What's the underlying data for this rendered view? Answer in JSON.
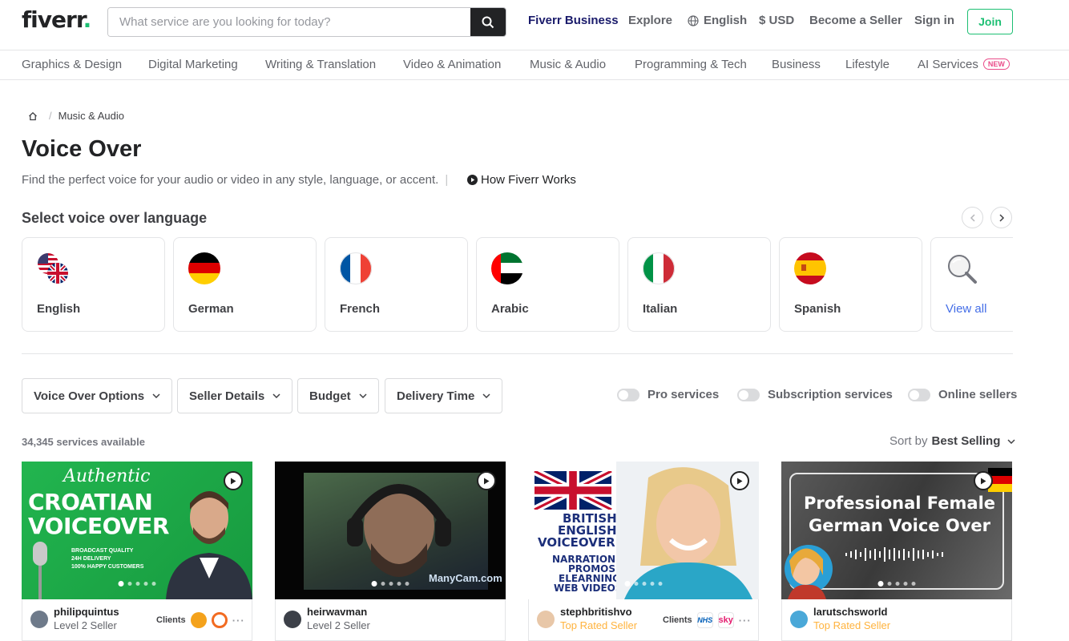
{
  "header": {
    "logo": "fiverr",
    "logo_dot": ".",
    "search_placeholder": "What service are you looking for today?",
    "nav": {
      "business": "Fiverr Business",
      "explore": "Explore",
      "language": "English",
      "currency": "$ USD",
      "become_seller": "Become a Seller",
      "sign_in": "Sign in",
      "join": "Join"
    }
  },
  "categories": [
    "Graphics & Design",
    "Digital Marketing",
    "Writing & Translation",
    "Video & Animation",
    "Music & Audio",
    "Programming & Tech",
    "Business",
    "Lifestyle",
    "AI Services"
  ],
  "new_badge": "NEW",
  "breadcrumb": {
    "sep": "/",
    "current": "Music & Audio"
  },
  "page": {
    "title": "Voice Over",
    "subtitle": "Find the perfect voice for your audio or video in any style, language, or accent.",
    "how_link": "How Fiverr Works"
  },
  "languages": {
    "heading": "Select voice over language",
    "items": [
      "English",
      "German",
      "French",
      "Arabic",
      "Italian",
      "Spanish",
      "View all"
    ]
  },
  "filters": {
    "dropdowns": [
      "Voice Over Options",
      "Seller Details",
      "Budget",
      "Delivery Time"
    ],
    "toggles": [
      "Pro services",
      "Subscription services",
      "Online sellers"
    ]
  },
  "results": {
    "count": "34,345 services available",
    "sort_label": "Sort by",
    "sort_value": "Best Selling"
  },
  "gigs": [
    {
      "thumb": {
        "line1": "Authentic",
        "line2": "CROATIAN",
        "line3": "VOICEOVER",
        "bullets": [
          "BROADCAST QUALITY",
          "24H DELIVERY",
          "100% HAPPY CUSTOMERS"
        ]
      },
      "seller": "philipquintus",
      "level": "Level 2 Seller",
      "clients_label": "Clients",
      "more": "···"
    },
    {
      "thumb": {
        "watermark": "ManyCam.com"
      },
      "seller": "heirwavman",
      "level": "Level 2 Seller"
    },
    {
      "thumb": {
        "line1": "BRITISH",
        "line2": "ENGLISH",
        "line3": "VOICEOVER",
        "line4": "NARRATION",
        "line5": "PROMOS",
        "line6": "ELEARNING",
        "line7": "WEB VIDEOS"
      },
      "seller": "stephbritishvo",
      "level": "Top Rated Seller",
      "clients_label": "Clients",
      "client_logos": [
        "NHS",
        "sky"
      ],
      "more": "···"
    },
    {
      "thumb": {
        "line1": "Professional Female",
        "line2": "German Voice Over"
      },
      "seller": "larutschsworld",
      "level": "Top Rated Seller"
    }
  ],
  "colors": {
    "brand_green": "#1dbf73",
    "business_navy": "#1a1b6b",
    "link_blue": "#446ee7",
    "top_rated": "#ffb33e",
    "new_pink": "#ea4c89"
  }
}
